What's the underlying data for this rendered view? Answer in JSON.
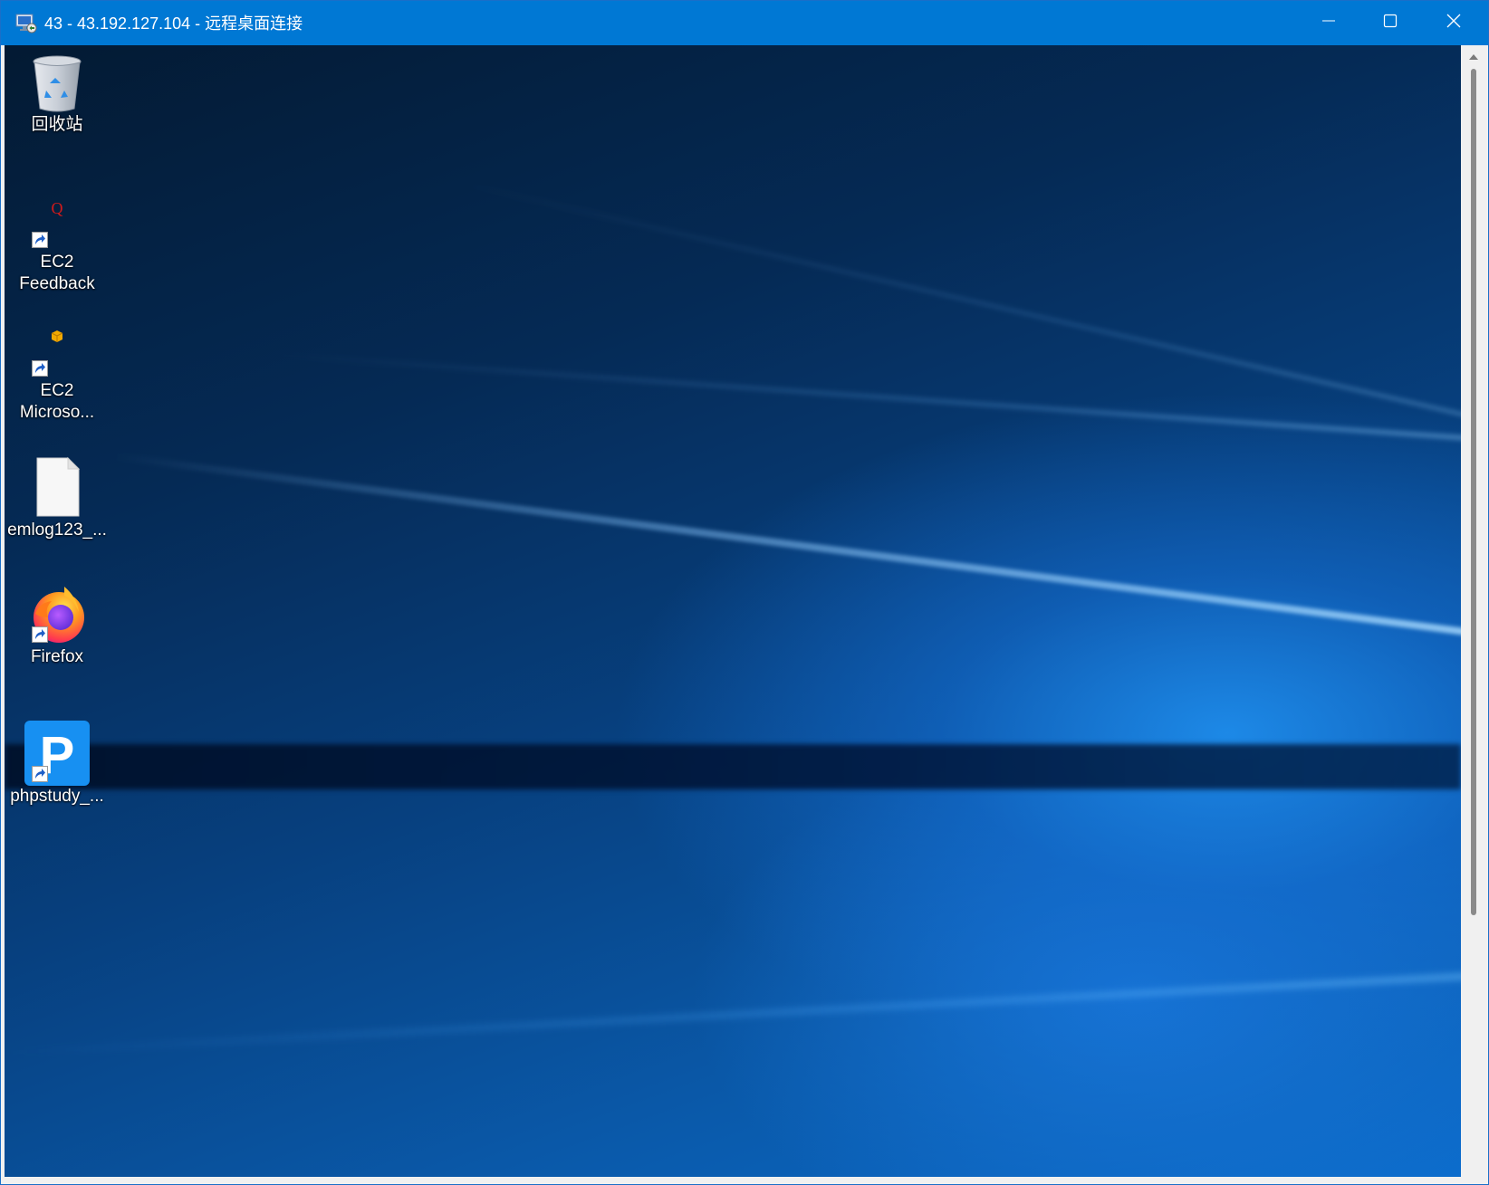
{
  "window": {
    "title": "43 - 43.192.127.104 - 远程桌面连接",
    "app_icon": "remote-desktop-icon",
    "controls": {
      "minimize": "minimize-icon",
      "maximize": "maximize-icon",
      "close": "close-icon"
    }
  },
  "desktop": {
    "icons": [
      {
        "label": "回收站",
        "icon": "recycle-bin-icon"
      },
      {
        "label": "EC2 Feedback",
        "label_lines": [
          "EC2",
          "Feedback"
        ],
        "icon": "ec2-feedback-icon",
        "shortcut": true
      },
      {
        "label": "EC2 Microso...",
        "label_lines": [
          "EC2",
          "Microso..."
        ],
        "icon": "ec2-microsoft-icon",
        "shortcut": true
      },
      {
        "label": "emlog123_...",
        "icon": "file-icon"
      },
      {
        "label": "Firefox",
        "icon": "firefox-icon",
        "shortcut": true
      },
      {
        "label": "phpstudy_...",
        "icon": "phpstudy-icon",
        "shortcut": true
      }
    ]
  },
  "colors": {
    "titlebar": "#0078d4",
    "title_text": "#ffffff",
    "desktop_dark": "#031a33",
    "desktop_light": "#0c6ccc"
  }
}
